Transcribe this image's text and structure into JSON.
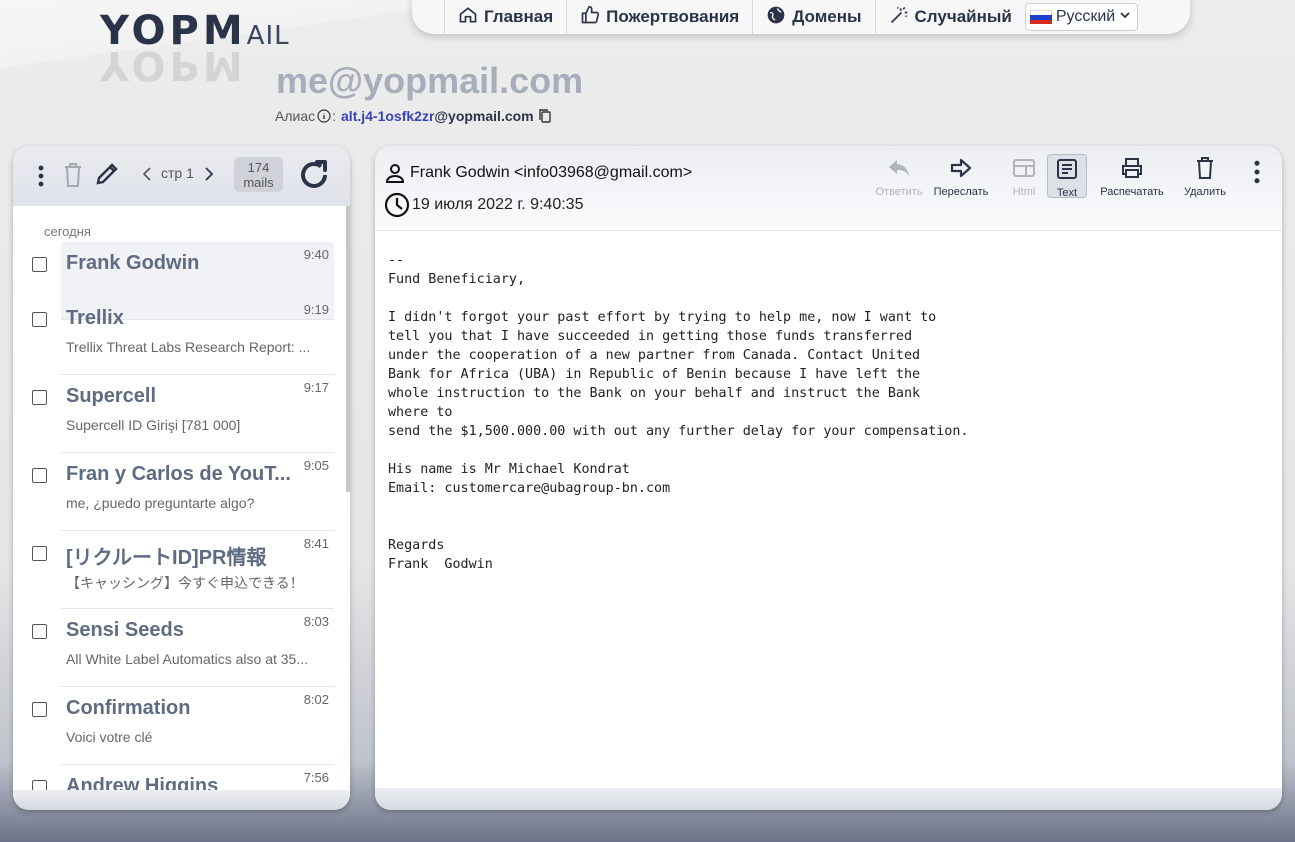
{
  "logo": {
    "text_main": "YOPM",
    "text_mail": "AIL"
  },
  "nav": {
    "home": "Главная",
    "donate": "Пожертвования",
    "domains": "Домены",
    "random": "Случайный",
    "language": "Русский"
  },
  "inbox_email": "me@yopmail.com",
  "alias": {
    "label": "Алиас",
    "sep": ":",
    "address": "alt.j4-1osfk2zr",
    "domain": "@yopmail.com"
  },
  "list_toolbar": {
    "page_label": "стр 1",
    "count": "174",
    "count_unit": "mails"
  },
  "list": {
    "day": "сегодня",
    "items": [
      {
        "from": "Frank Godwin",
        "time": "9:40",
        "subject": ""
      },
      {
        "from": "Trellix",
        "time": "9:19",
        "subject": "Trellix Threat Labs Research Report: ..."
      },
      {
        "from": "Supercell",
        "time": "9:17",
        "subject": "Supercell ID Girişi [781 000]"
      },
      {
        "from": "Fran y Carlos de YouT...",
        "time": "9:05",
        "subject": "me, ¿puedo preguntarte algo?"
      },
      {
        "from": "[リクルートID]PR情報",
        "time": "8:41",
        "subject": "【キャッシング】今すぐ申込できる！"
      },
      {
        "from": "Sensi Seeds",
        "time": "8:03",
        "subject": "All White Label Automatics also at 35..."
      },
      {
        "from": "Confirmation",
        "time": "8:02",
        "subject": "Voici votre clé"
      },
      {
        "from": "Andrew Higgins",
        "time": "7:56",
        "subject": ""
      }
    ]
  },
  "message": {
    "sender": "Frank Godwin <info03968@gmail.com>",
    "date": "19 июля 2022 г. 9:40:35",
    "actions": {
      "reply": "Ответить",
      "forward": "Переслать",
      "html": "Html",
      "text": "Text",
      "print": "Распечатать",
      "delete": "Удалить"
    },
    "body": "--\nFund Beneficiary,\n\nI didn't forgot your past effort by trying to help me, now I want to\ntell you that I have succeeded in getting those funds transferred\nunder the cooperation of a new partner from Canada. Contact United\nBank for Africa (UBA) in Republic of Benin because I have left the\nwhole instruction to the Bank on your behalf and instruct the Bank\nwhere to\nsend the $1,500.000.00 with out any further delay for your compensation.\n\nHis name is Mr Michael Kondrat\nEmail: customercare@ubagroup-bn.com\n\n\nRegards\nFrank  Godwin"
  },
  "colors": {
    "accent": "#2a3348",
    "alias_link": "#3a44b8",
    "sender_gray": "#5f6b83"
  }
}
